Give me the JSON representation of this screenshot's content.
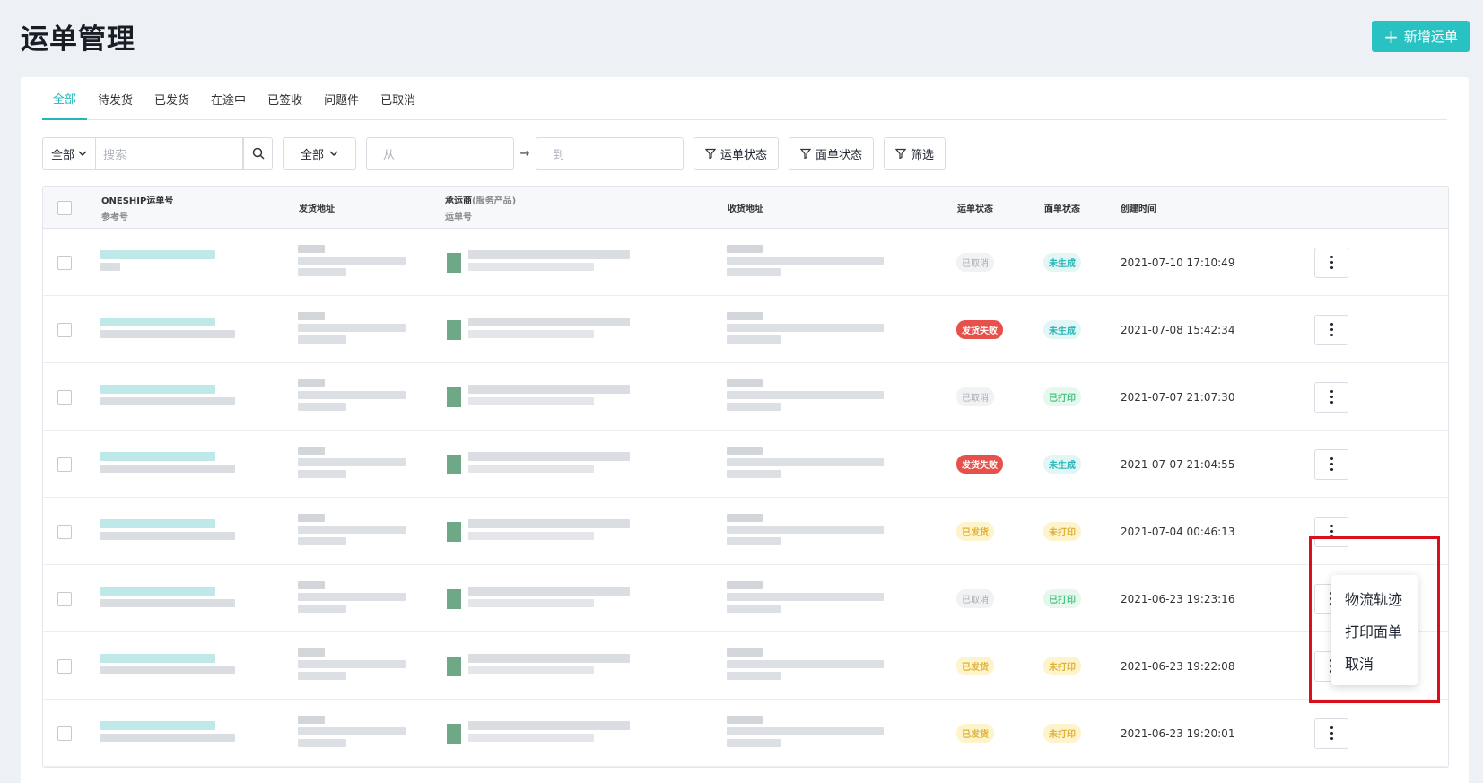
{
  "page": {
    "title": "运单管理",
    "add_button": "新增运单"
  },
  "tabs": [
    {
      "label": "全部",
      "active": true
    },
    {
      "label": "待发货"
    },
    {
      "label": "已发货"
    },
    {
      "label": "在途中"
    },
    {
      "label": "已签收"
    },
    {
      "label": "问题件"
    },
    {
      "label": "已取消"
    }
  ],
  "filters": {
    "scope_select": "全部",
    "search_placeholder": "搜索",
    "type_select": "全部",
    "date_from_placeholder": "从",
    "date_arrow": "→",
    "date_to_placeholder": "到",
    "waybill_status_btn": "运单状态",
    "label_status_btn": "面单状态",
    "filter_btn": "筛选"
  },
  "table": {
    "headers": {
      "oneship": "ONESHIP运单号",
      "ref": "参考号",
      "sender": "发货地址",
      "carrier": "承运商",
      "carrier_paren": "(服务产品)",
      "carrier_sub": "运单号",
      "receiver": "收货地址",
      "waybill_status": "运单状态",
      "label_status": "面单状态",
      "created": "创建时间"
    },
    "rows": [
      {
        "waybill_status": "已取消",
        "ws_type": "cancel",
        "label_status": "未生成",
        "ls_type": "ungen",
        "created": "2021-07-10 17:10:49"
      },
      {
        "waybill_status": "发货失败",
        "ws_type": "fail",
        "label_status": "未生成",
        "ls_type": "ungen",
        "created": "2021-07-08 15:42:34"
      },
      {
        "waybill_status": "已取消",
        "ws_type": "cancel",
        "label_status": "已打印",
        "ls_type": "printed",
        "created": "2021-07-07 21:07:30"
      },
      {
        "waybill_status": "发货失败",
        "ws_type": "fail",
        "label_status": "未生成",
        "ls_type": "ungen",
        "created": "2021-07-07 21:04:55"
      },
      {
        "waybill_status": "已发货",
        "ws_type": "shipped",
        "label_status": "未打印",
        "ls_type": "unprinted",
        "created": "2021-07-04 00:46:13"
      },
      {
        "waybill_status": "已取消",
        "ws_type": "cancel",
        "label_status": "已打印",
        "ls_type": "printed",
        "created": "2021-06-23 19:23:16"
      },
      {
        "waybill_status": "已发货",
        "ws_type": "shipped",
        "label_status": "未打印",
        "ls_type": "unprinted",
        "created": "2021-06-23 19:22:08"
      },
      {
        "waybill_status": "已发货",
        "ws_type": "shipped",
        "label_status": "未打印",
        "ls_type": "unprinted",
        "created": "2021-06-23 19:20:01"
      }
    ]
  },
  "dropdown_menu": {
    "items": [
      "物流轨迹",
      "打印面单",
      "取消"
    ]
  },
  "colors": {
    "accent": "#29c2c2",
    "fail": "#e6524b",
    "highlight": "#d9101a",
    "background": "#edf0f5"
  }
}
